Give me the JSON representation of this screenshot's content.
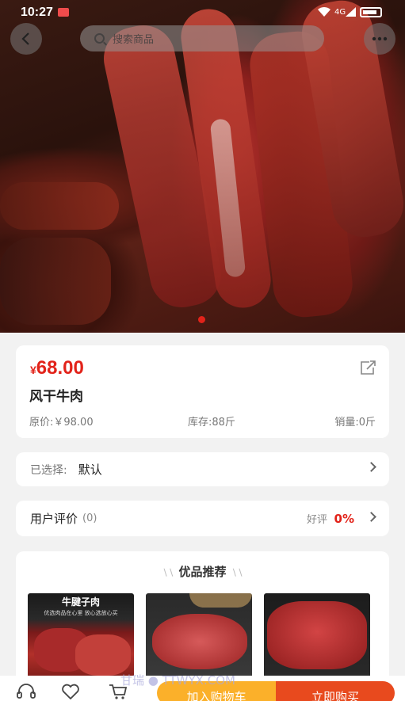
{
  "status": {
    "time": "10:27",
    "signal": "4G"
  },
  "nav": {
    "search_placeholder": "搜索商品"
  },
  "product": {
    "currency": "¥",
    "price": "68.00",
    "name": "风干牛肉",
    "original_price": "原价:￥98.00",
    "stock": "库存:88斤",
    "sales": "销量:0斤"
  },
  "selection": {
    "label": "已选择:",
    "value": "默认"
  },
  "reviews": {
    "label": "用户评价",
    "count": "(0)",
    "good_label": "好评",
    "good_rate": "0%"
  },
  "recommend": {
    "title": "优品推荐",
    "items": [
      {
        "label": "牛腱子肉",
        "caption": "优选肉品在心里 放心选放心买"
      },
      {
        "label": ""
      },
      {
        "label": ""
      }
    ]
  },
  "actions": {
    "add_cart": "加入购物车",
    "buy_now": "立即购买"
  },
  "watermark": "甘瑞 ● TTWYX.COM",
  "colors": {
    "accent": "#e2231a",
    "cart_button": "#fbb02a",
    "buy_button": "#e84a1e"
  }
}
